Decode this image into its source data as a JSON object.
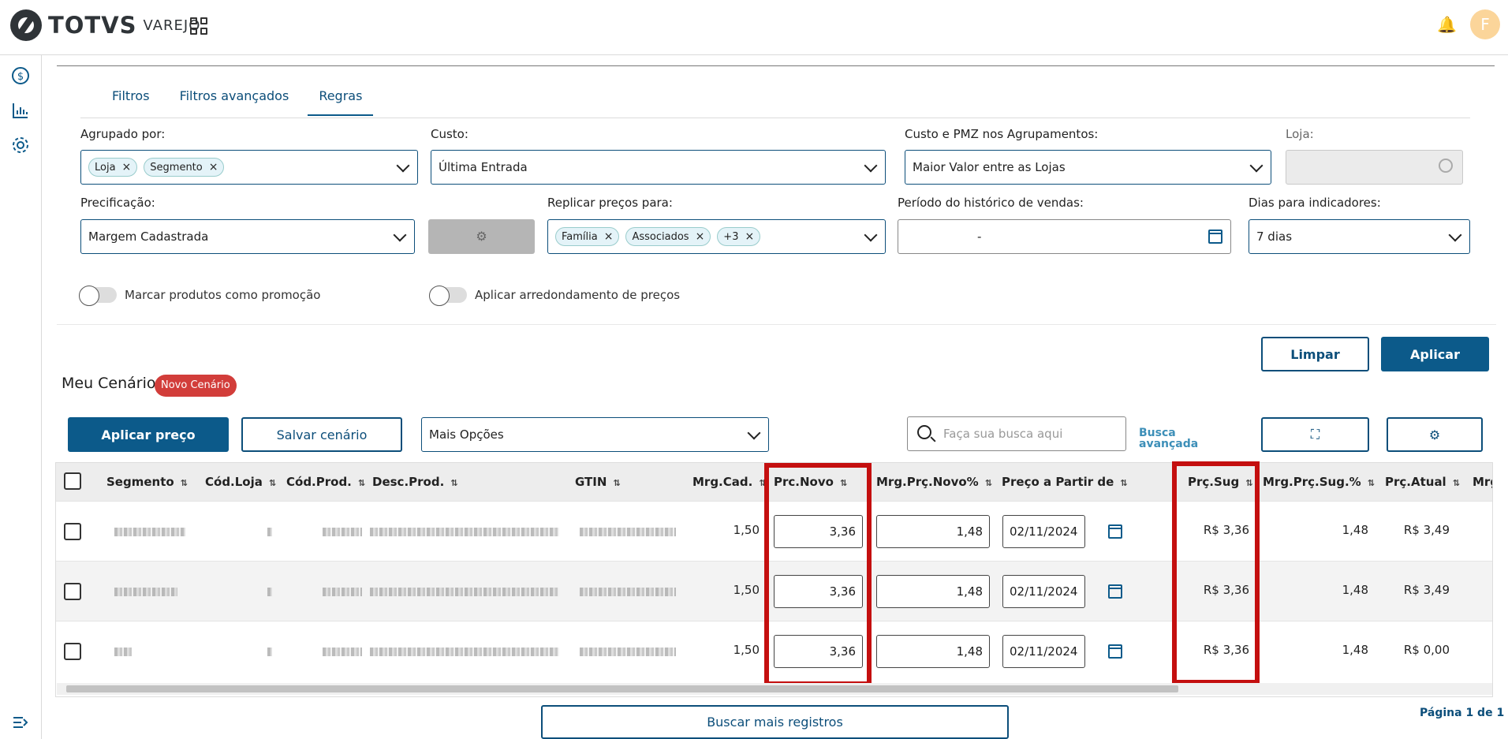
{
  "app": {
    "brand": "TOTVS",
    "product": "VAREJO",
    "avatar_letter": "F"
  },
  "tabs": [
    "Filtros",
    "Filtros avançados",
    "Regras"
  ],
  "rules": {
    "agrupado_label": "Agrupado por:",
    "agrupado_chips": [
      "Loja",
      "Segmento"
    ],
    "custo_label": "Custo:",
    "custo_value": "Última Entrada",
    "pmz_label": "Custo e PMZ nos Agrupamentos:",
    "pmz_value": "Maior Valor entre as Lojas",
    "loja_label": "Loja:",
    "precificacao_label": "Precificação:",
    "precificacao_value": "Margem Cadastrada",
    "replicar_label": "Replicar preços para:",
    "replicar_chips": [
      "Família",
      "Associados",
      "+3"
    ],
    "periodo_label": "Período do histórico de vendas:",
    "periodo_value": "-",
    "dias_label": "Dias para indicadores:",
    "dias_value": "7 dias",
    "promo_toggle": "Marcar produtos como promoção",
    "arred_toggle": "Aplicar arredondamento de preços",
    "limpar": "Limpar",
    "aplicar": "Aplicar"
  },
  "scenario": {
    "title": "Meu Cenário",
    "badge": "Novo Cenário",
    "aplicar_preco": "Aplicar preço",
    "salvar": "Salvar cenário",
    "mais_opcoes": "Mais Opções",
    "search_placeholder": "Faça sua busca aqui",
    "busca_line1": "Busca",
    "busca_line2": "avançada"
  },
  "table": {
    "headers": [
      "Segmento",
      "Cód.Loja",
      "Cód.Prod.",
      "Desc.Prod.",
      "GTIN",
      "Mrg.Cad.",
      "Prc.Novo",
      "Mrg.Prç.Novo%",
      "Preço a Partir de",
      "Prç.Sug",
      "Mrg.Prç.Sug.%",
      "Prç.Atual",
      "Mrg"
    ],
    "rows": [
      {
        "mrg_cad": "1,50",
        "prc_novo": "3,36",
        "mrg_novo": "1,48",
        "data": "02/11/2024",
        "prc_sug": "R$ 3,36",
        "mrg_sug": "1,48",
        "prc_atual": "R$ 3,49"
      },
      {
        "mrg_cad": "1,50",
        "prc_novo": "3,36",
        "mrg_novo": "1,48",
        "data": "02/11/2024",
        "prc_sug": "R$ 3,36",
        "mrg_sug": "1,48",
        "prc_atual": "R$ 3,49"
      },
      {
        "mrg_cad": "1,50",
        "prc_novo": "3,36",
        "mrg_novo": "1,48",
        "data": "02/11/2024",
        "prc_sug": "R$ 3,36",
        "mrg_sug": "1,48",
        "prc_atual": "R$ 0,00"
      }
    ]
  },
  "footer": {
    "more": "Buscar mais registros",
    "pager": "Página 1 de 1"
  },
  "colors": {
    "primary": "#0c5a8a",
    "badge": "#d23d3a",
    "highlight": "#c40f0f"
  }
}
